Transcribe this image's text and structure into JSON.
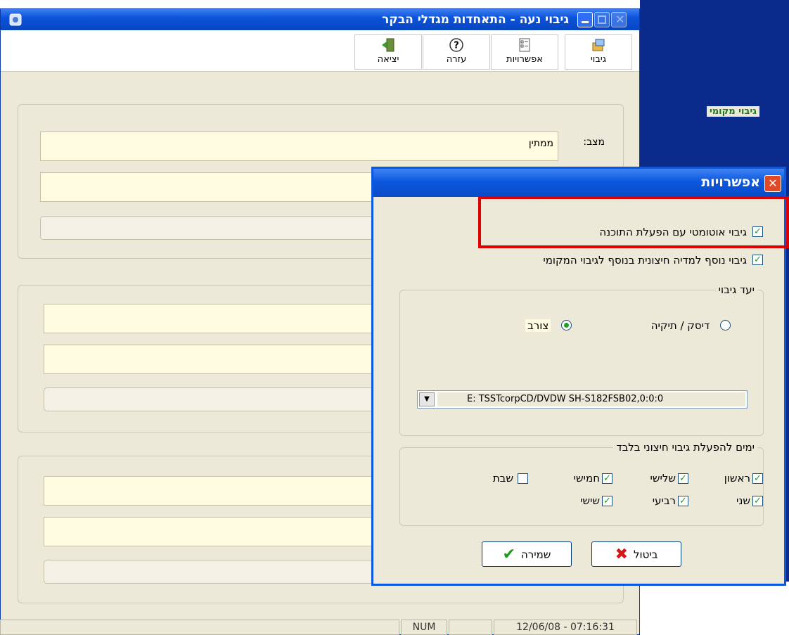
{
  "main_window": {
    "title": "גיבוי נעה - התאחדות מגדלי הבקר"
  },
  "toolbar": {
    "backup": "גיבוי",
    "options": "אפשרויות",
    "help": "עזרה",
    "exit": "יציאה"
  },
  "local_backup": {
    "title": "גיבוי מקומי",
    "status_label": "מצב:",
    "status_value": "ממתין"
  },
  "statusbar": {
    "num": "NUM",
    "datetime": "12/06/08 - 07:16:31"
  },
  "dialog": {
    "title": "אפשרויות",
    "auto_start_label": "גיבוי אוטומטי עם הפעלת התוכנה",
    "auto_start_checked": true,
    "external_label": "גיבוי נוסף למדיה חיצונית בנוסף לגיבוי המקומי",
    "external_checked": true,
    "destination": {
      "title": "יעד גיבוי",
      "disk_label": "דיסק / תיקיה",
      "burner_label": "צורב",
      "selected": "burner",
      "drive_value": "E: TSSTcorpCD/DVDW SH-S182FSB02,0:0:0"
    },
    "days": {
      "title": "ימים להפעלת גיבוי חיצוני בלבד",
      "sunday": "ראשון",
      "monday": "שני",
      "tuesday": "שלישי",
      "wednesday": "רביעי",
      "thursday": "חמישי",
      "friday": "שישי",
      "saturday": "שבת"
    },
    "save_label": "שמירה",
    "cancel_label": "ביטול"
  }
}
